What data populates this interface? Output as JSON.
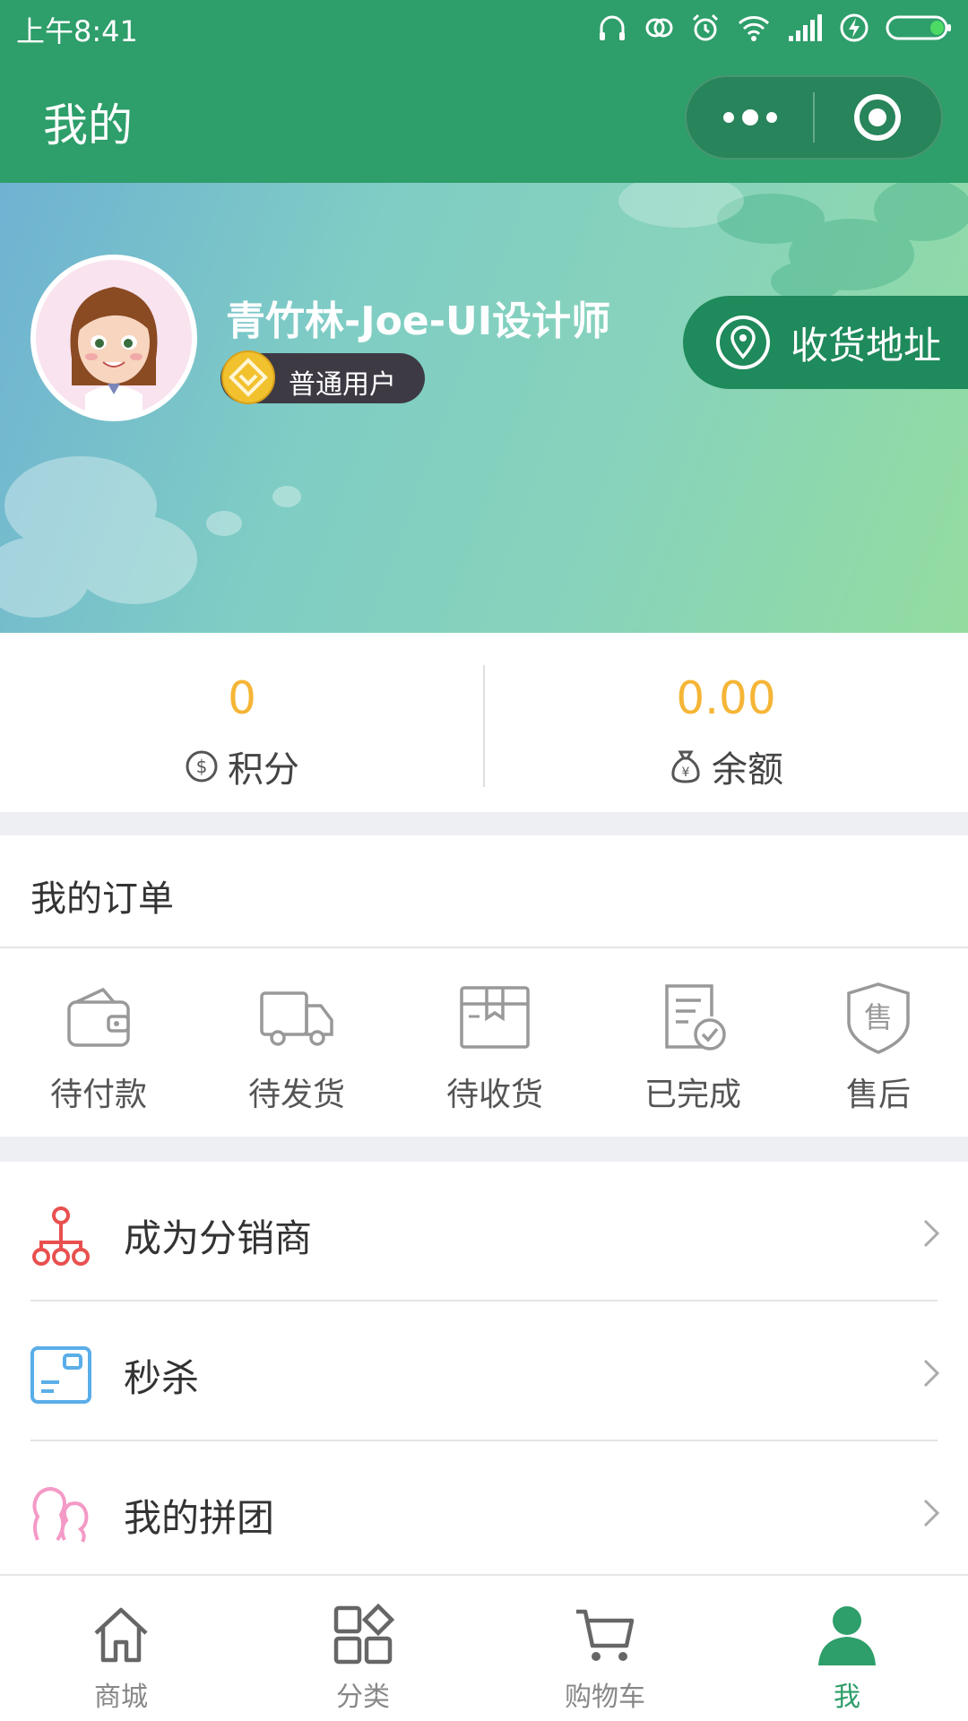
{
  "status_bar": {
    "time": "上午8:41"
  },
  "nav": {
    "title": "我的"
  },
  "profile": {
    "username": "青竹林-Joe-UI设计师",
    "level": "普通用户",
    "address_button": "收货地址"
  },
  "stats": {
    "points": {
      "value": "0",
      "label": "积分"
    },
    "balance": {
      "value": "0.00",
      "label": "余额"
    }
  },
  "orders": {
    "title": "我的订单",
    "items": [
      {
        "label": "待付款",
        "icon": "wallet-icon"
      },
      {
        "label": "待发货",
        "icon": "truck-icon"
      },
      {
        "label": "待收货",
        "icon": "package-icon"
      },
      {
        "label": "已完成",
        "icon": "document-check-icon"
      },
      {
        "label": "售后",
        "icon": "shield-icon"
      }
    ]
  },
  "menu": [
    {
      "label": "成为分销商",
      "icon": "distribution-network-icon"
    },
    {
      "label": "秒杀",
      "icon": "flash-sale-card-icon"
    },
    {
      "label": "我的拼团",
      "icon": "group-buy-icon"
    }
  ],
  "tabbar": [
    {
      "label": "商城",
      "icon": "home-icon",
      "active": false
    },
    {
      "label": "分类",
      "icon": "category-grid-icon",
      "active": false
    },
    {
      "label": "购物车",
      "icon": "cart-icon",
      "active": false
    },
    {
      "label": "我",
      "icon": "person-icon",
      "active": true
    }
  ],
  "colors": {
    "primary_green": "#2e9e6a",
    "accent_gold": "#f5b536",
    "menu_red": "#e8504f",
    "menu_blue": "#5aaee8",
    "menu_pink": "#f49ac7"
  }
}
